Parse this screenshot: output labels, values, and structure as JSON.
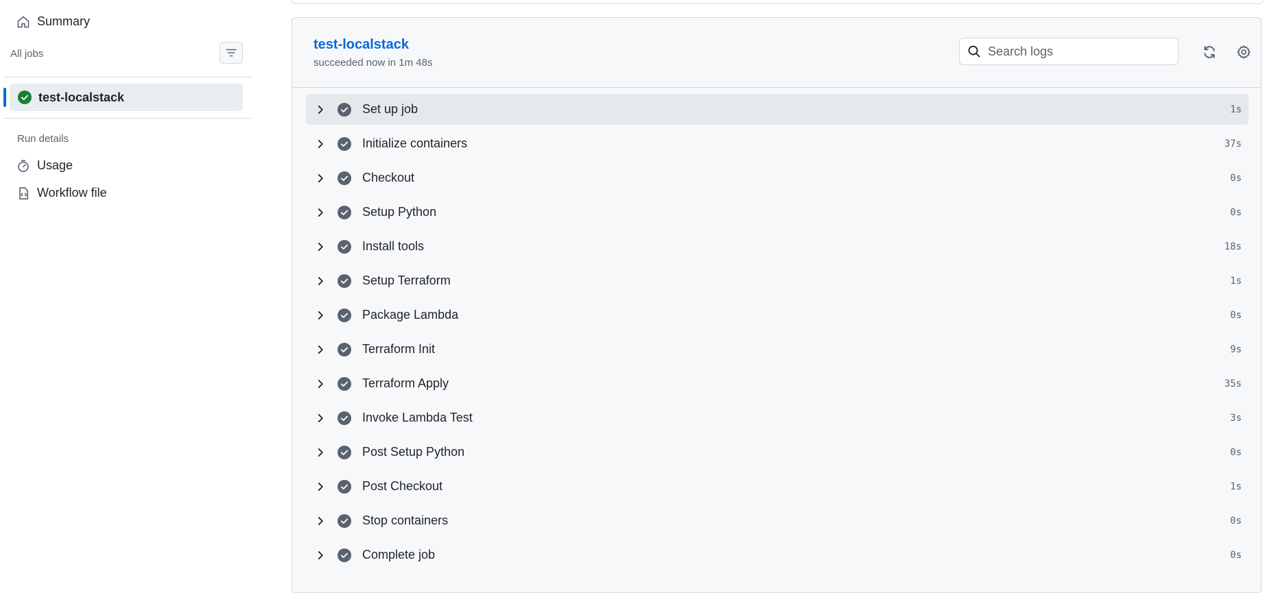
{
  "sidebar": {
    "summary_label": "Summary",
    "all_jobs_label": "All jobs",
    "jobs": [
      {
        "name": "test-localstack",
        "status": "success"
      }
    ],
    "run_details_label": "Run details",
    "usage_label": "Usage",
    "workflow_file_label": "Workflow file"
  },
  "job": {
    "title": "test-localstack",
    "status_text": "succeeded now in 1m 48s",
    "search_placeholder": "Search logs",
    "steps": [
      {
        "name": "Set up job",
        "duration": "1s"
      },
      {
        "name": "Initialize containers",
        "duration": "37s"
      },
      {
        "name": "Checkout",
        "duration": "0s"
      },
      {
        "name": "Setup Python",
        "duration": "0s"
      },
      {
        "name": "Install tools",
        "duration": "18s"
      },
      {
        "name": "Setup Terraform",
        "duration": "1s"
      },
      {
        "name": "Package Lambda",
        "duration": "0s"
      },
      {
        "name": "Terraform Init",
        "duration": "9s"
      },
      {
        "name": "Terraform Apply",
        "duration": "35s"
      },
      {
        "name": "Invoke Lambda Test",
        "duration": "3s"
      },
      {
        "name": "Post Setup Python",
        "duration": "0s"
      },
      {
        "name": "Post Checkout",
        "duration": "1s"
      },
      {
        "name": "Stop containers",
        "duration": "0s"
      },
      {
        "name": "Complete job",
        "duration": "0s"
      }
    ]
  },
  "colors": {
    "accent": "#0969da",
    "success": "#1a7f37",
    "step_check": "#59636e"
  }
}
